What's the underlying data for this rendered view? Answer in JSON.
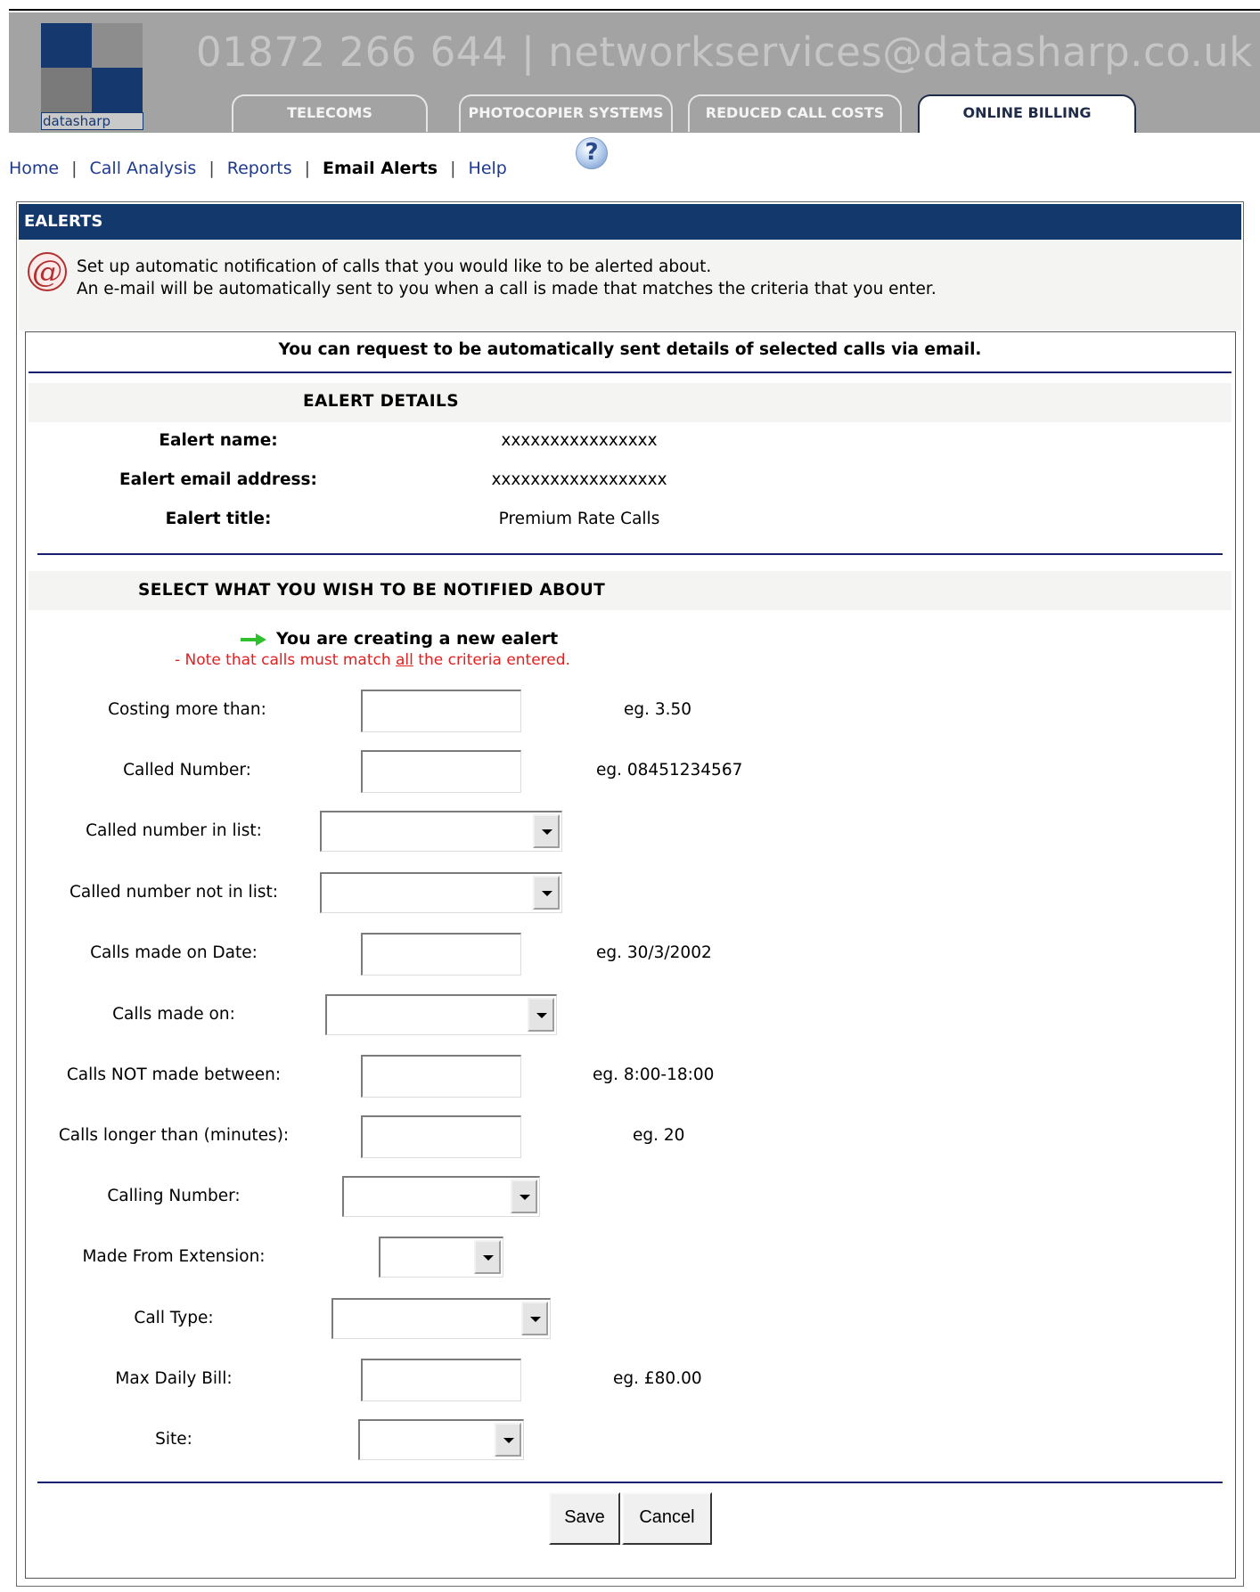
{
  "header": {
    "logo_text": "datasharp",
    "contact": "01872 266 644 | networkservices@datasharp.co.uk",
    "tabs": [
      "TELECOMS",
      "PHOTOCOPIER SYSTEMS",
      "REDUCED CALL COSTS",
      "ONLINE BILLING"
    ],
    "active_tab": "ONLINE BILLING"
  },
  "nav": {
    "items": [
      "Home",
      "Call Analysis",
      "Reports",
      "Email Alerts",
      "Help"
    ],
    "separator": "|",
    "current": "Email Alerts",
    "help_icon": "help-question-icon"
  },
  "panel": {
    "title": "EALERTS",
    "intro_line1": "Set up automatic notification of calls that you would like to be alerted about.",
    "intro_line2": "An e-mail will be automatically sent to you when a call is made that matches the criteria that you enter.",
    "icon": "at-sign-icon"
  },
  "form": {
    "request_text": "You can request to be automatically sent details of selected calls via email.",
    "details_heading": "EALERT DETAILS",
    "details": [
      {
        "label": "Ealert name:",
        "value": "xxxxxxxxxxxxxxxx"
      },
      {
        "label": "Ealert email address:",
        "value": "xxxxxxxxxxxxxxxxxx"
      },
      {
        "label": "Ealert title:",
        "value": "Premium Rate Calls"
      }
    ],
    "notify_heading": "SELECT WHAT YOU WISH TO BE NOTIFIED ABOUT",
    "creating_text": "You are creating a new ealert",
    "note_prefix": "- Note that calls must match ",
    "note_em": "all",
    "note_suffix": " the criteria entered.",
    "fields": [
      {
        "label": "Costing more than:",
        "type": "text",
        "value": "",
        "hint": "eg. 3.50"
      },
      {
        "label": "Called Number:",
        "type": "text",
        "value": "",
        "hint": "eg. 08451234567"
      },
      {
        "label": "Called number in list:",
        "type": "select",
        "value": ""
      },
      {
        "label": "Called number not in list:",
        "type": "select",
        "value": ""
      },
      {
        "label": "Calls made on Date:",
        "type": "text",
        "value": "",
        "hint": "eg. 30/3/2002"
      },
      {
        "label": "Calls made on:",
        "type": "select",
        "value": ""
      },
      {
        "label": "Calls NOT made between:",
        "type": "text",
        "value": "",
        "hint": "eg. 8:00-18:00"
      },
      {
        "label": "Calls longer than (minutes):",
        "type": "text",
        "value": "",
        "hint": "eg. 20"
      },
      {
        "label": "Calling Number:",
        "type": "select",
        "value": ""
      },
      {
        "label": "Made From Extension:",
        "type": "select",
        "value": ""
      },
      {
        "label": "Call Type:",
        "type": "select",
        "value": ""
      },
      {
        "label": "Max Daily Bill:",
        "type": "text",
        "value": "",
        "hint": "eg. £80.00"
      },
      {
        "label": "Site:",
        "type": "select",
        "value": ""
      }
    ],
    "buttons": {
      "save": "Save",
      "cancel": "Cancel"
    }
  },
  "colors": {
    "banner": "#a3a3a3",
    "title_bar": "#13386b",
    "link": "#1d3a8f",
    "note_red": "#e02020",
    "arrow_green": "#2fbf2f"
  }
}
